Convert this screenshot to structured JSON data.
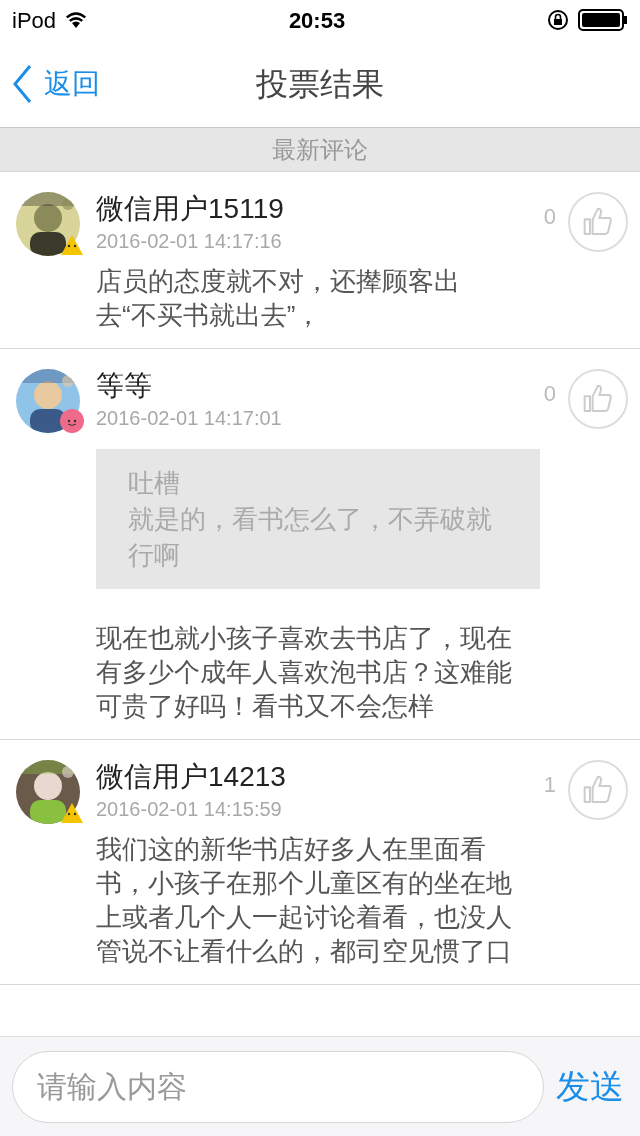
{
  "status_bar": {
    "carrier": "iPod",
    "time": "20:53"
  },
  "nav": {
    "back": "返回",
    "title": "投票结果"
  },
  "section_header": "最新评论",
  "comments": [
    {
      "name": "微信用户15119",
      "time": "2016-02-01 14:17:16",
      "likes": "0",
      "badge": {
        "kind": "triangle",
        "color": "#f5c400"
      },
      "text": "店员的态度就不对，还撵顾客出去“不买书就出去”，"
    },
    {
      "name": "等等",
      "time": "2016-02-01 14:17:01",
      "likes": "0",
      "badge": {
        "kind": "circle",
        "color": "#f06a8a"
      },
      "quote": {
        "label": "吐槽",
        "text": "就是的，看书怎么了，不弄破就行啊"
      },
      "text": "现在也就小孩子喜欢去书店了，现在有多少个成年人喜欢泡书店？这难能可贵了好吗！看书又不会怎样"
    },
    {
      "name": "微信用户14213",
      "time": "2016-02-01 14:15:59",
      "likes": "1",
      "badge": {
        "kind": "triangle",
        "color": "#f5c400"
      },
      "text": "我们这的新华书店好多人在里面看书，小孩子在那个儿童区有的坐在地上或者几个人一起讨论着看，也没人管说不让看什么的，都司空见惯了口"
    }
  ],
  "input": {
    "placeholder": "请输入内容",
    "send": "发送"
  }
}
